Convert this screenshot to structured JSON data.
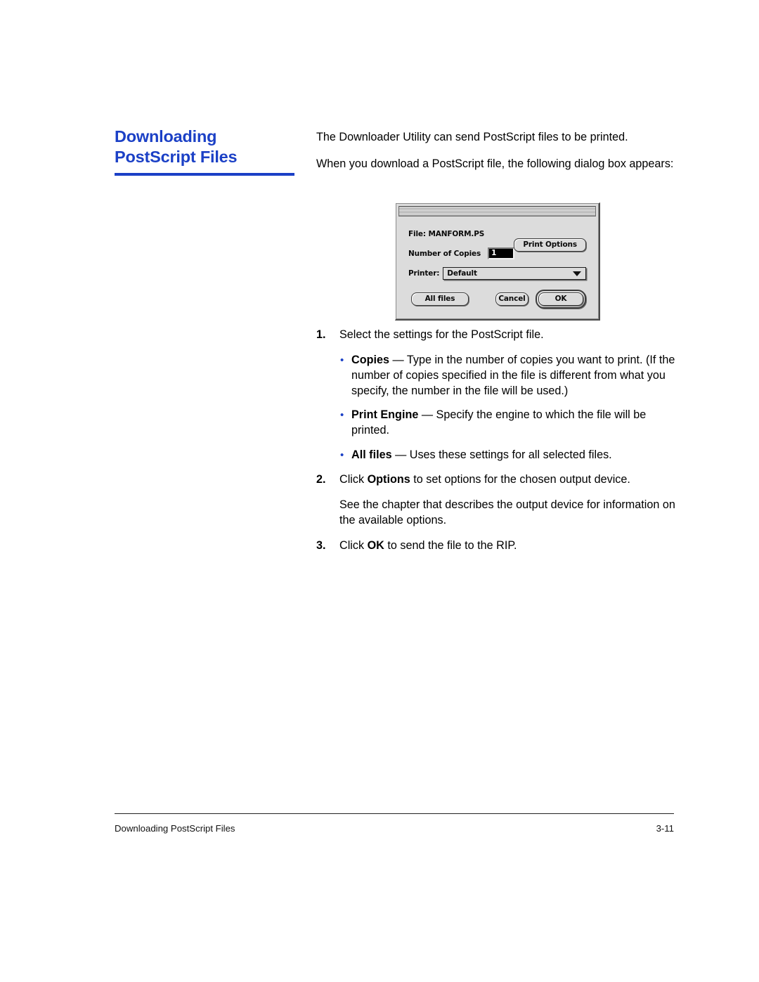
{
  "heading": {
    "line1": "Downloading",
    "line2": "PostScript Files"
  },
  "intro": {
    "paragraph1": "The Downloader Utility can send PostScript files to be printed.",
    "paragraph2": "When you download a PostScript file, the following dialog box appears:"
  },
  "dialog": {
    "title": "",
    "file_label": "File: MANFORM.PS",
    "copies_label": "Number of Copies",
    "copies_value": "1",
    "print_options_label": "Print Options",
    "printer_label": "Printer:",
    "printer_value": "Default",
    "caret_icon": "chevron-down-icon",
    "all_files_label": "All files",
    "cancel_label": "Cancel",
    "ok_label": "OK"
  },
  "steps": [
    {
      "number": "1.",
      "text": "Select the settings for the PostScript file."
    },
    {
      "number": "2.",
      "text_prefix": "Click ",
      "text_bold": "Options",
      "text_suffix": " to set options for the chosen output device."
    },
    {
      "number": "3.",
      "text_prefix": "Click ",
      "text_bold": "OK",
      "text_suffix": " to send the file to the RIP."
    }
  ],
  "bullets": [
    {
      "marker": "•",
      "term": "Copies",
      "dash": " — ",
      "description": "Type in the number of copies you want to print. (If the number of copies specified in the file is different from what you specify, the number in the file will be used.)"
    },
    {
      "marker": "•",
      "term": "Print Engine",
      "dash": " — ",
      "description": "Specify the engine to which the file will be printed."
    },
    {
      "marker": "•",
      "term": "All files",
      "dash": " — ",
      "description": "Uses these settings for all selected files."
    }
  ],
  "note": {
    "text": "See the chapter that describes the output device for information on the available options."
  },
  "footer": {
    "left": "Downloading PostScript Files",
    "right": "3-11"
  },
  "colors": {
    "accent_blue": "#1b40c6",
    "text_black": "#000000",
    "dialog_face": "#dcdcdc"
  }
}
